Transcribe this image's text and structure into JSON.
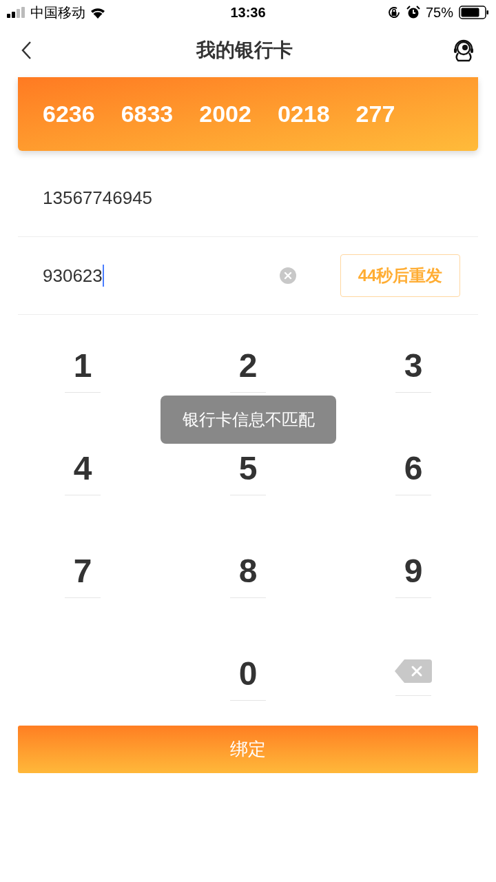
{
  "status_bar": {
    "carrier": "中国移动",
    "time": "13:36",
    "battery": "75%"
  },
  "header": {
    "title": "我的银行卡"
  },
  "card": {
    "number_groups": [
      "6236",
      "6833",
      "2002",
      "0218",
      "277"
    ]
  },
  "phone_field": {
    "value": "13567746945"
  },
  "code_field": {
    "value": "930623",
    "resend_button": "44秒后重发"
  },
  "keypad": [
    {
      "kind": "digit",
      "label": "1"
    },
    {
      "kind": "digit",
      "label": "2"
    },
    {
      "kind": "digit",
      "label": "3"
    },
    {
      "kind": "digit",
      "label": "4"
    },
    {
      "kind": "digit",
      "label": "5"
    },
    {
      "kind": "digit",
      "label": "6"
    },
    {
      "kind": "digit",
      "label": "7"
    },
    {
      "kind": "digit",
      "label": "8"
    },
    {
      "kind": "digit",
      "label": "9"
    },
    {
      "kind": "blank"
    },
    {
      "kind": "digit",
      "label": "0"
    },
    {
      "kind": "backspace"
    }
  ],
  "toast": {
    "message": "银行卡信息不匹配"
  },
  "bind_button": {
    "label": "绑定"
  }
}
